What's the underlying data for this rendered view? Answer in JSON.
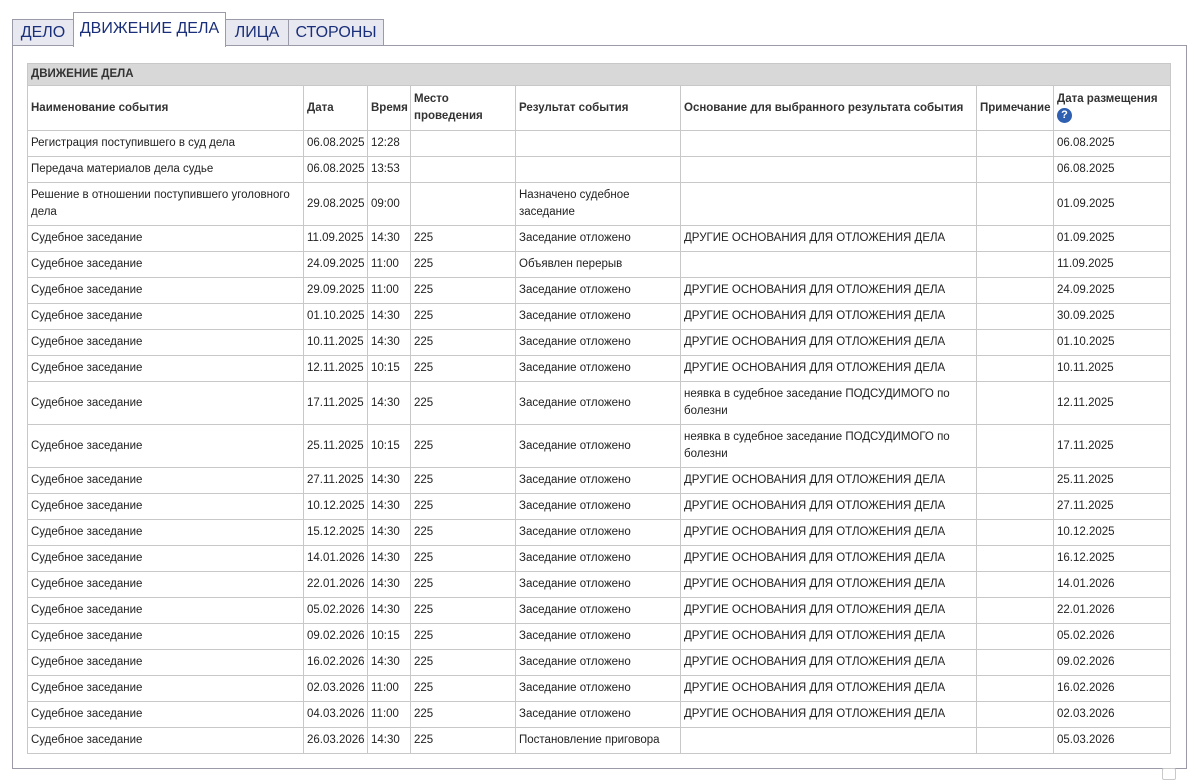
{
  "tabs": [
    {
      "label": "ДЕЛО",
      "active": false
    },
    {
      "label": "ДВИЖЕНИЕ ДЕЛА",
      "active": true
    },
    {
      "label": "ЛИЦА",
      "active": false
    },
    {
      "label": "СТОРОНЫ",
      "active": false
    }
  ],
  "table": {
    "caption": "ДВИЖЕНИЕ ДЕЛА",
    "columns": {
      "event": "Наименование события",
      "date": "Дата",
      "time": "Время",
      "place": "Место проведения",
      "result": "Результат события",
      "basis": "Основание для выбранного результата события",
      "note": "Примечание",
      "posted": "Дата размещения",
      "help_icon": "?"
    },
    "rows": [
      {
        "event": "Регистрация поступившего в суд дела",
        "date": "06.08.2025",
        "time": "12:28",
        "place": "",
        "result": "",
        "basis": "",
        "note": "",
        "posted": "06.08.2025"
      },
      {
        "event": "Передача материалов дела судье",
        "date": "06.08.2025",
        "time": "13:53",
        "place": "",
        "result": "",
        "basis": "",
        "note": "",
        "posted": "06.08.2025"
      },
      {
        "event": "Решение в отношении поступившего уголовного дела",
        "date": "29.08.2025",
        "time": "09:00",
        "place": "",
        "result": "Назначено судебное заседание",
        "basis": "",
        "note": "",
        "posted": "01.09.2025"
      },
      {
        "event": "Судебное заседание",
        "date": "11.09.2025",
        "time": "14:30",
        "place": "225",
        "result": "Заседание отложено",
        "basis": "ДРУГИЕ ОСНОВАНИЯ ДЛЯ ОТЛОЖЕНИЯ ДЕЛА",
        "note": "",
        "posted": "01.09.2025"
      },
      {
        "event": "Судебное заседание",
        "date": "24.09.2025",
        "time": "11:00",
        "place": "225",
        "result": "Объявлен перерыв",
        "basis": "",
        "note": "",
        "posted": "11.09.2025"
      },
      {
        "event": "Судебное заседание",
        "date": "29.09.2025",
        "time": "11:00",
        "place": "225",
        "result": "Заседание отложено",
        "basis": "ДРУГИЕ ОСНОВАНИЯ ДЛЯ ОТЛОЖЕНИЯ ДЕЛА",
        "note": "",
        "posted": "24.09.2025"
      },
      {
        "event": "Судебное заседание",
        "date": "01.10.2025",
        "time": "14:30",
        "place": "225",
        "result": "Заседание отложено",
        "basis": "ДРУГИЕ ОСНОВАНИЯ ДЛЯ ОТЛОЖЕНИЯ ДЕЛА",
        "note": "",
        "posted": "30.09.2025"
      },
      {
        "event": "Судебное заседание",
        "date": "10.11.2025",
        "time": "14:30",
        "place": "225",
        "result": "Заседание отложено",
        "basis": "ДРУГИЕ ОСНОВАНИЯ ДЛЯ ОТЛОЖЕНИЯ ДЕЛА",
        "note": "",
        "posted": "01.10.2025"
      },
      {
        "event": "Судебное заседание",
        "date": "12.11.2025",
        "time": "10:15",
        "place": "225",
        "result": "Заседание отложено",
        "basis": "ДРУГИЕ ОСНОВАНИЯ ДЛЯ ОТЛОЖЕНИЯ ДЕЛА",
        "note": "",
        "posted": "10.11.2025"
      },
      {
        "event": "Судебное заседание",
        "date": "17.11.2025",
        "time": "14:30",
        "place": "225",
        "result": "Заседание отложено",
        "basis": "неявка в судебное заседание ПОДСУДИМОГО по болезни",
        "note": "",
        "posted": "12.11.2025"
      },
      {
        "event": "Судебное заседание",
        "date": "25.11.2025",
        "time": "10:15",
        "place": "225",
        "result": "Заседание отложено",
        "basis": "неявка в судебное заседание ПОДСУДИМОГО по болезни",
        "note": "",
        "posted": "17.11.2025"
      },
      {
        "event": "Судебное заседание",
        "date": "27.11.2025",
        "time": "14:30",
        "place": "225",
        "result": "Заседание отложено",
        "basis": "ДРУГИЕ ОСНОВАНИЯ ДЛЯ ОТЛОЖЕНИЯ ДЕЛА",
        "note": "",
        "posted": "25.11.2025"
      },
      {
        "event": "Судебное заседание",
        "date": "10.12.2025",
        "time": "14:30",
        "place": "225",
        "result": "Заседание отложено",
        "basis": "ДРУГИЕ ОСНОВАНИЯ ДЛЯ ОТЛОЖЕНИЯ ДЕЛА",
        "note": "",
        "posted": "27.11.2025"
      },
      {
        "event": "Судебное заседание",
        "date": "15.12.2025",
        "time": "14:30",
        "place": "225",
        "result": "Заседание отложено",
        "basis": "ДРУГИЕ ОСНОВАНИЯ ДЛЯ ОТЛОЖЕНИЯ ДЕЛА",
        "note": "",
        "posted": "10.12.2025"
      },
      {
        "event": "Судебное заседание",
        "date": "14.01.2026",
        "time": "14:30",
        "place": "225",
        "result": "Заседание отложено",
        "basis": "ДРУГИЕ ОСНОВАНИЯ ДЛЯ ОТЛОЖЕНИЯ ДЕЛА",
        "note": "",
        "posted": "16.12.2025"
      },
      {
        "event": "Судебное заседание",
        "date": "22.01.2026",
        "time": "14:30",
        "place": "225",
        "result": "Заседание отложено",
        "basis": "ДРУГИЕ ОСНОВАНИЯ ДЛЯ ОТЛОЖЕНИЯ ДЕЛА",
        "note": "",
        "posted": "14.01.2026"
      },
      {
        "event": "Судебное заседание",
        "date": "05.02.2026",
        "time": "14:30",
        "place": "225",
        "result": "Заседание отложено",
        "basis": "ДРУГИЕ ОСНОВАНИЯ ДЛЯ ОТЛОЖЕНИЯ ДЕЛА",
        "note": "",
        "posted": "22.01.2026"
      },
      {
        "event": "Судебное заседание",
        "date": "09.02.2026",
        "time": "10:15",
        "place": "225",
        "result": "Заседание отложено",
        "basis": "ДРУГИЕ ОСНОВАНИЯ ДЛЯ ОТЛОЖЕНИЯ ДЕЛА",
        "note": "",
        "posted": "05.02.2026"
      },
      {
        "event": "Судебное заседание",
        "date": "16.02.2026",
        "time": "14:30",
        "place": "225",
        "result": "Заседание отложено",
        "basis": "ДРУГИЕ ОСНОВАНИЯ ДЛЯ ОТЛОЖЕНИЯ ДЕЛА",
        "note": "",
        "posted": "09.02.2026"
      },
      {
        "event": "Судебное заседание",
        "date": "02.03.2026",
        "time": "11:00",
        "place": "225",
        "result": "Заседание отложено",
        "basis": "ДРУГИЕ ОСНОВАНИЯ ДЛЯ ОТЛОЖЕНИЯ ДЕЛА",
        "note": "",
        "posted": "16.02.2026"
      },
      {
        "event": "Судебное заседание",
        "date": "04.03.2026",
        "time": "11:00",
        "place": "225",
        "result": "Заседание отложено",
        "basis": "ДРУГИЕ ОСНОВАНИЯ ДЛЯ ОТЛОЖЕНИЯ ДЕЛА",
        "note": "",
        "posted": "02.03.2026"
      },
      {
        "event": "Судебное заседание",
        "date": "26.03.2026",
        "time": "14:30",
        "place": "225",
        "result": "Постановление приговора",
        "basis": "",
        "note": "",
        "posted": "05.03.2026"
      }
    ]
  },
  "colors": {
    "tab_text": "#1a2f7a",
    "caption_bg": "#d8d8d8",
    "grid": "#c8c8c8",
    "help_icon": "#2e5fb0"
  }
}
